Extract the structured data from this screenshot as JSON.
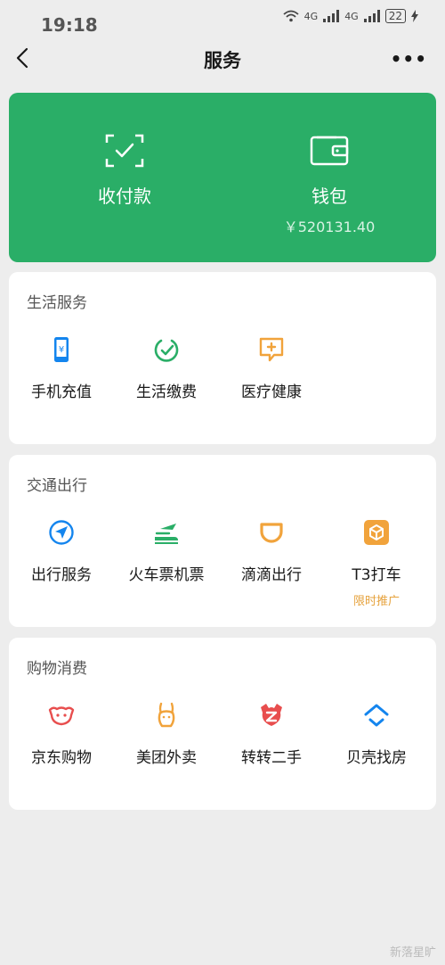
{
  "status": {
    "time": "19:18",
    "net1": "4G",
    "net2": "4G",
    "battery": "22"
  },
  "nav": {
    "title": "服务",
    "more": "•••"
  },
  "wallet_card": {
    "pay_label": "收付款",
    "wallet_label": "钱包",
    "balance": "￥520131.40"
  },
  "sections": {
    "life": {
      "title": "生活服务",
      "items": [
        {
          "label": "手机充值"
        },
        {
          "label": "生活缴费"
        },
        {
          "label": "医疗健康"
        }
      ]
    },
    "travel": {
      "title": "交通出行",
      "items": [
        {
          "label": "出行服务"
        },
        {
          "label": "火车票机票"
        },
        {
          "label": "滴滴出行"
        },
        {
          "label": "T3打车",
          "promo": "限时推广"
        }
      ]
    },
    "shopping": {
      "title": "购物消费",
      "items": [
        {
          "label": "京东购物"
        },
        {
          "label": "美团外卖"
        },
        {
          "label": "转转二手"
        },
        {
          "label": "贝壳找房"
        }
      ]
    }
  },
  "watermark": "新落星旷",
  "colors": {
    "green": "#2aae67",
    "blue": "#1485ee",
    "orange": "#f1a33b",
    "promo": "#e6a23c"
  }
}
